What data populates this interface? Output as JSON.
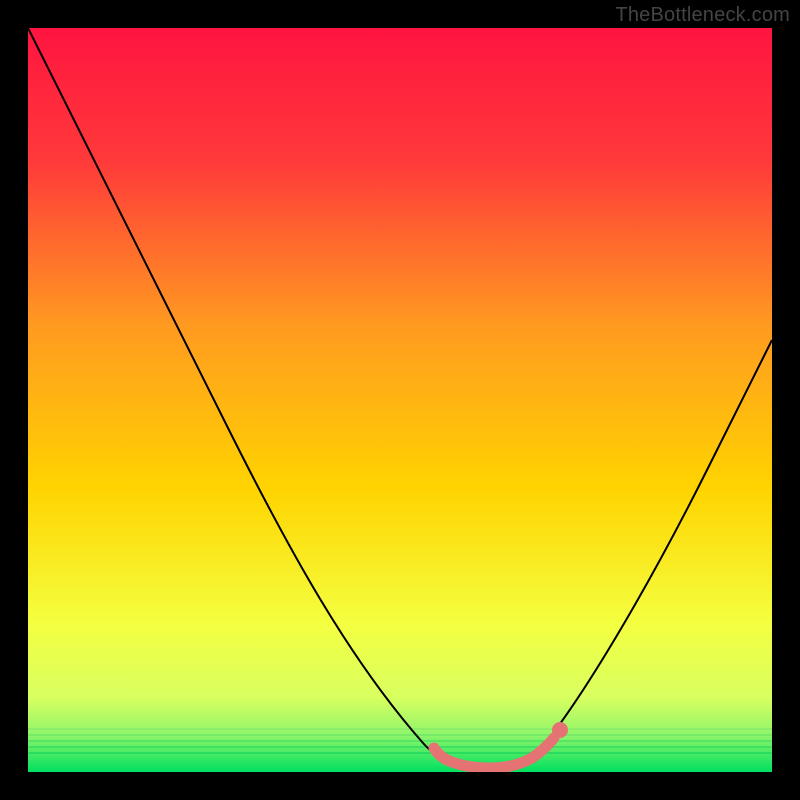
{
  "watermark": {
    "text": "TheBottleneck.com"
  },
  "colors": {
    "frame": "#000000",
    "watermark": "#444444",
    "curve": "#000000",
    "marker_fill": "#e57373",
    "marker_stroke": "#b54848",
    "gradient_top": "#ff1440",
    "gradient_mid1": "#ff7a2a",
    "gradient_mid2": "#ffd400",
    "gradient_mid3": "#f7ff3a",
    "gradient_bottom": "#00e060"
  },
  "chart_data": {
    "type": "line",
    "title": "",
    "xlabel": "",
    "ylabel": "",
    "xlim": [
      0,
      100
    ],
    "ylim": [
      0,
      100
    ],
    "x": [
      0,
      5,
      10,
      15,
      20,
      25,
      30,
      35,
      40,
      45,
      50,
      52,
      55,
      57,
      60,
      62,
      64,
      66,
      68,
      70,
      75,
      80,
      85,
      90,
      95,
      100
    ],
    "values": [
      100,
      90,
      80,
      70,
      60,
      50,
      41,
      33,
      25,
      18,
      11,
      8,
      5,
      3,
      1,
      0.5,
      0.5,
      1,
      2.5,
      5,
      14,
      24,
      34,
      43,
      51,
      58
    ],
    "optimal_region": {
      "x_start": 55,
      "x_end": 72,
      "y_max": 4
    },
    "optimal_marker": {
      "x": 72,
      "y": 6
    }
  }
}
